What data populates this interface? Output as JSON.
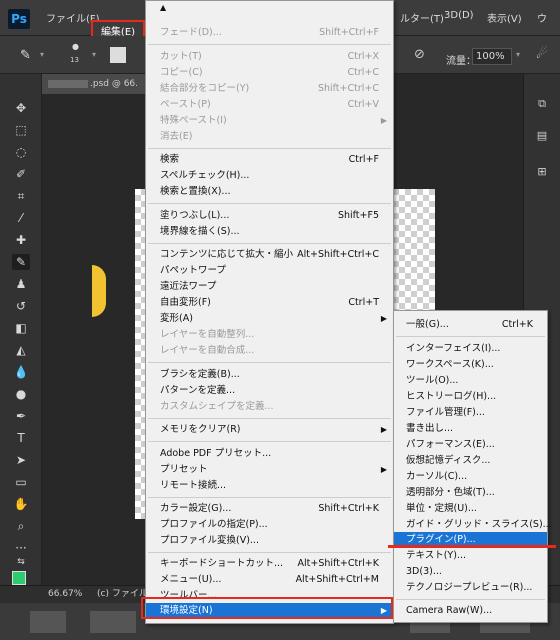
{
  "menubar": {
    "logo": "Ps",
    "items": [
      {
        "label": "ファイル(F)"
      },
      {
        "label": "編集(E)"
      },
      {
        "label": "ルター(T)"
      },
      {
        "label": "3D(D)"
      },
      {
        "label": "表示(V)"
      },
      {
        "label": "ウ"
      }
    ]
  },
  "options": {
    "flow_label": "流量：",
    "flow_value": "100%",
    "brush_size": "13"
  },
  "doc_tab": {
    "name": ".psd @ 66."
  },
  "status": {
    "zoom": "66.67%",
    "file": "(c) ファイル"
  },
  "edit_menu": {
    "scroll_up": "▲",
    "items": [
      {
        "label": "フェード(D)...",
        "shortcut": "Shift+Ctrl+F",
        "disabled": true
      },
      {
        "label": "カット(T)",
        "shortcut": "Ctrl+X",
        "disabled": true
      },
      {
        "label": "コピー(C)",
        "shortcut": "Ctrl+C",
        "disabled": true
      },
      {
        "label": "結合部分をコピー(Y)",
        "shortcut": "Shift+Ctrl+C",
        "disabled": true
      },
      {
        "label": "ペースト(P)",
        "shortcut": "Ctrl+V",
        "disabled": true
      },
      {
        "label": "特殊ペースト(I)",
        "shortcut": "",
        "disabled": true,
        "submenu": true
      },
      {
        "label": "消去(E)",
        "shortcut": "",
        "disabled": true
      },
      {
        "label": "検索",
        "shortcut": "Ctrl+F"
      },
      {
        "label": "スペルチェック(H)...",
        "shortcut": ""
      },
      {
        "label": "検索と置換(X)...",
        "shortcut": ""
      },
      {
        "label": "塗りつぶし(L)...",
        "shortcut": "Shift+F5"
      },
      {
        "label": "境界線を描く(S)...",
        "shortcut": ""
      },
      {
        "label": "コンテンツに応じて拡大・縮小",
        "shortcut": "Alt+Shift+Ctrl+C"
      },
      {
        "label": "パペットワープ",
        "shortcut": ""
      },
      {
        "label": "遠近法ワープ",
        "shortcut": ""
      },
      {
        "label": "自由変形(F)",
        "shortcut": "Ctrl+T"
      },
      {
        "label": "変形(A)",
        "shortcut": "",
        "submenu": true
      },
      {
        "label": "レイヤーを自動整列...",
        "shortcut": "",
        "disabled": true
      },
      {
        "label": "レイヤーを自動合成...",
        "shortcut": "",
        "disabled": true
      },
      {
        "label": "ブラシを定義(B)...",
        "shortcut": ""
      },
      {
        "label": "パターンを定義...",
        "shortcut": ""
      },
      {
        "label": "カスタムシェイプを定義...",
        "shortcut": "",
        "disabled": true
      },
      {
        "label": "メモリをクリア(R)",
        "shortcut": "",
        "submenu": true
      },
      {
        "label": "Adobe PDF プリセット...",
        "shortcut": ""
      },
      {
        "label": "プリセット",
        "shortcut": "",
        "submenu": true
      },
      {
        "label": "リモート接続...",
        "shortcut": ""
      },
      {
        "label": "カラー設定(G)...",
        "shortcut": "Shift+Ctrl+K"
      },
      {
        "label": "プロファイルの指定(P)...",
        "shortcut": ""
      },
      {
        "label": "プロファイル変換(V)...",
        "shortcut": ""
      },
      {
        "label": "キーボードショートカット...",
        "shortcut": "Alt+Shift+Ctrl+K"
      },
      {
        "label": "メニュー(U)...",
        "shortcut": "Alt+Shift+Ctrl+M"
      },
      {
        "label": "ツールバー...",
        "shortcut": ""
      },
      {
        "label": "環境設定(N)",
        "shortcut": "",
        "submenu": true,
        "highlighted": true
      }
    ]
  },
  "pref_menu": {
    "items": [
      {
        "label": "一般(G)...",
        "shortcut": "Ctrl+K"
      },
      {
        "label": "インターフェイス(I)...",
        "shortcut": ""
      },
      {
        "label": "ワークスペース(K)...",
        "shortcut": ""
      },
      {
        "label": "ツール(O)...",
        "shortcut": ""
      },
      {
        "label": "ヒストリーログ(H)...",
        "shortcut": ""
      },
      {
        "label": "ファイル管理(F)...",
        "shortcut": ""
      },
      {
        "label": "書き出し...",
        "shortcut": ""
      },
      {
        "label": "パフォーマンス(E)...",
        "shortcut": ""
      },
      {
        "label": "仮想記憶ディスク...",
        "shortcut": ""
      },
      {
        "label": "カーソル(C)...",
        "shortcut": ""
      },
      {
        "label": "透明部分・色域(T)...",
        "shortcut": ""
      },
      {
        "label": "単位・定規(U)...",
        "shortcut": ""
      },
      {
        "label": "ガイド・グリッド・スライス(S)...",
        "shortcut": ""
      },
      {
        "label": "プラグイン(P)...",
        "shortcut": "",
        "highlighted": true
      },
      {
        "label": "テキスト(Y)...",
        "shortcut": ""
      },
      {
        "label": "3D(3)...",
        "shortcut": ""
      },
      {
        "label": "テクノロジープレビュー(R)...",
        "shortcut": ""
      },
      {
        "label": "Camera Raw(W)...",
        "shortcut": ""
      }
    ]
  },
  "colors": {
    "highlight": "#1a74d6",
    "annotation_red": "#e8291c",
    "foreground_swatch": "#2ecc71"
  }
}
